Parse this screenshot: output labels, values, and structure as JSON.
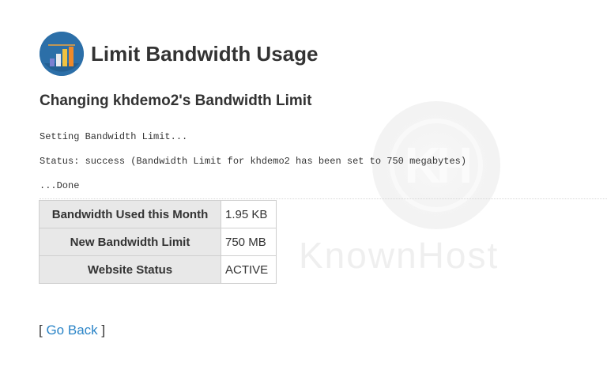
{
  "header": {
    "title": "Limit Bandwidth Usage",
    "icon": "bandwidth-bars-icon",
    "icon_color": "#2c6fa8"
  },
  "subheading": "Changing khdemo2's Bandwidth Limit",
  "log": [
    "Setting Bandwidth Limit...",
    "Status: success (Bandwidth Limit for khdemo2 has been set to 750 megabytes)",
    "...Done"
  ],
  "stats": [
    {
      "label": "Bandwidth Used this Month",
      "value": "1.95 KB"
    },
    {
      "label": "New Bandwidth Limit",
      "value": "750 MB"
    },
    {
      "label": "Website Status",
      "value": "ACTIVE"
    }
  ],
  "back": {
    "prefix": "[ ",
    "label": "Go Back",
    "suffix": " ]",
    "link_color": "#2a84c7"
  },
  "watermark": {
    "text": "KnownHost",
    "mark": "KH"
  }
}
